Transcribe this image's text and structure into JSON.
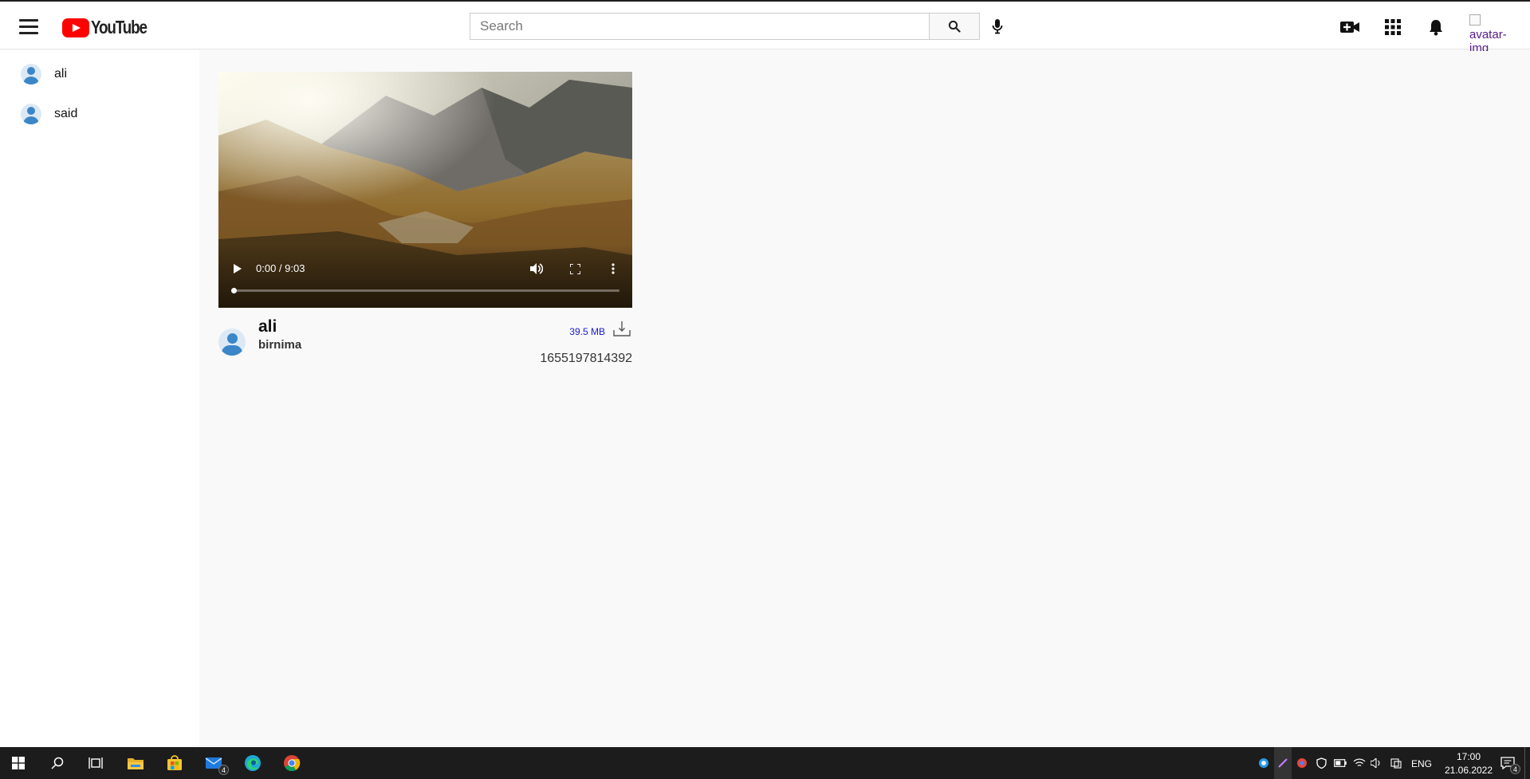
{
  "header": {
    "logo_text": "YouTube",
    "search_placeholder": "Search",
    "avatar_alt": "avatar-img",
    "icons": [
      "menu-icon",
      "search-icon",
      "mic-icon",
      "create-video-icon",
      "apps-icon",
      "notifications-icon"
    ]
  },
  "sidebar": {
    "items": [
      {
        "label": "ali",
        "icon": "person-icon"
      },
      {
        "label": "said",
        "icon": "person-icon"
      }
    ]
  },
  "video": {
    "time": "0:00 / 9:03",
    "progress": 0,
    "channel": "ali",
    "description": "birnima",
    "size": "39.5 MB",
    "timestamp": "1655197814392",
    "icons": [
      "play-icon",
      "volume-icon",
      "fullscreen-icon",
      "more-vert-icon",
      "download-icon"
    ]
  },
  "taskbar": {
    "apps": [
      "windows-start-icon",
      "search-icon",
      "task-view-icon",
      "file-explorer-icon",
      "store-icon",
      "mail-icon",
      "edge-icon",
      "chrome-icon"
    ],
    "mail_badge": "4",
    "language": "ENG",
    "time": "17:00",
    "date": "21.06.2022",
    "notification_count": "4"
  },
  "colors": {
    "brand_red": "#ff0000",
    "background": "#f9f9f9",
    "avatar_blue": "#3a86c8",
    "size_link": "#1a1ad6",
    "taskbar": "#1c1c1c"
  }
}
